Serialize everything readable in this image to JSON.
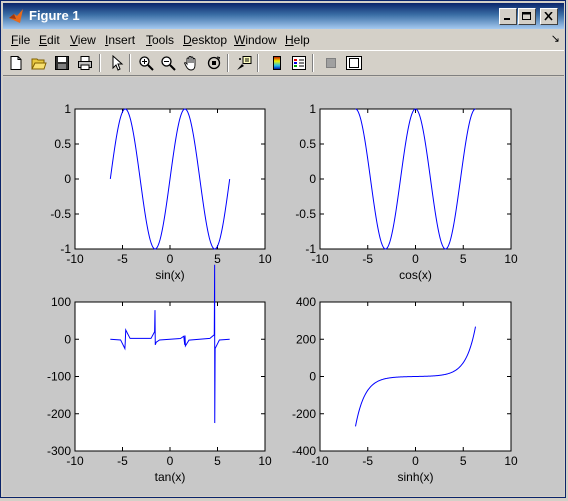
{
  "window": {
    "title": "Figure 1",
    "controls": [
      "minimize-icon",
      "maximize-icon",
      "close-icon"
    ]
  },
  "menu": {
    "items": [
      {
        "pre": "",
        "u": "F",
        "post": "ile"
      },
      {
        "pre": "",
        "u": "E",
        "post": "dit"
      },
      {
        "pre": "",
        "u": "V",
        "post": "iew"
      },
      {
        "pre": "",
        "u": "I",
        "post": "nsert"
      },
      {
        "pre": "",
        "u": "T",
        "post": "ools"
      },
      {
        "pre": "",
        "u": "D",
        "post": "esktop"
      },
      {
        "pre": "",
        "u": "W",
        "post": "indow"
      },
      {
        "pre": "",
        "u": "H",
        "post": "elp"
      }
    ],
    "dock_arrow": "↘"
  },
  "toolbar": {
    "icons": [
      "new-figure-icon",
      "open-file-icon",
      "save-icon",
      "print-icon",
      "edit-plot-arrow-icon",
      "zoom-in-icon",
      "zoom-out-icon",
      "pan-hand-icon",
      "rotate-3d-icon",
      "data-cursor-icon",
      "insert-colorbar-icon",
      "insert-legend-icon",
      "hide-plot-tools-icon",
      "show-plot-tools-icon"
    ]
  },
  "chart_data": [
    {
      "type": "line",
      "function": "sin",
      "xlabel": "sin(x)",
      "xlim": [
        -10,
        10
      ],
      "ylim": [
        -1,
        1
      ],
      "xticks": [
        -10,
        -5,
        0,
        5,
        10
      ],
      "yticks": [
        -1,
        -0.5,
        0,
        0.5,
        1
      ],
      "ytick_labels": [
        "-1",
        "-0.5",
        "0",
        "0.5",
        "1"
      ],
      "x_range": [
        -6.283,
        6.283
      ],
      "series_color": "#0000ff"
    },
    {
      "type": "line",
      "function": "cos",
      "xlabel": "cos(x)",
      "xlim": [
        -10,
        10
      ],
      "ylim": [
        -1,
        1
      ],
      "xticks": [
        -10,
        -5,
        0,
        5,
        10
      ],
      "yticks": [
        -1,
        -0.5,
        0,
        0.5,
        1
      ],
      "ytick_labels": [
        "-1",
        "-0.5",
        "0",
        "0.5",
        "1"
      ],
      "x_range": [
        -6.283,
        6.283
      ],
      "series_color": "#0000ff"
    },
    {
      "type": "line",
      "function": "tan",
      "xlabel": "tan(x)",
      "xlim": [
        -10,
        10
      ],
      "ylim": [
        -300,
        100
      ],
      "xticks": [
        -10,
        -5,
        0,
        5,
        10
      ],
      "yticks": [
        -300,
        -200,
        -100,
        0,
        100
      ],
      "ytick_labels": [
        "-300",
        "-200",
        "-100",
        "0",
        "100"
      ],
      "x_range": [
        -6.283,
        6.283
      ],
      "points": [
        [
          -6.283,
          0
        ],
        [
          -5.2,
          -1.9
        ],
        [
          -4.75,
          -25
        ],
        [
          -4.71,
          -8
        ],
        [
          -4.66,
          25
        ],
        [
          -4.2,
          2.2
        ],
        [
          -2.0,
          2.2
        ],
        [
          -1.62,
          20
        ],
        [
          -1.58,
          78
        ],
        [
          -1.55,
          -15
        ],
        [
          -1.45,
          -8
        ],
        [
          -1.1,
          -2
        ],
        [
          1.1,
          2
        ],
        [
          1.45,
          8
        ],
        [
          1.55,
          -15
        ],
        [
          1.58,
          10
        ],
        [
          1.62,
          -18
        ],
        [
          2.0,
          -2.2
        ],
        [
          4.2,
          2.2
        ],
        [
          4.66,
          12
        ],
        [
          4.7,
          200
        ],
        [
          4.71,
          -225
        ],
        [
          4.75,
          -25
        ],
        [
          5.2,
          -1.9
        ],
        [
          6.283,
          0
        ]
      ],
      "series_color": "#0000ff"
    },
    {
      "type": "line",
      "function": "sinh",
      "xlabel": "sinh(x)",
      "xlim": [
        -10,
        10
      ],
      "ylim": [
        -400,
        400
      ],
      "xticks": [
        -10,
        -5,
        0,
        5,
        10
      ],
      "yticks": [
        -400,
        -200,
        0,
        200,
        400
      ],
      "ytick_labels": [
        "-400",
        "-200",
        "0",
        "200",
        "400"
      ],
      "x_range": [
        -6.283,
        6.283
      ],
      "series_color": "#0000ff"
    }
  ]
}
